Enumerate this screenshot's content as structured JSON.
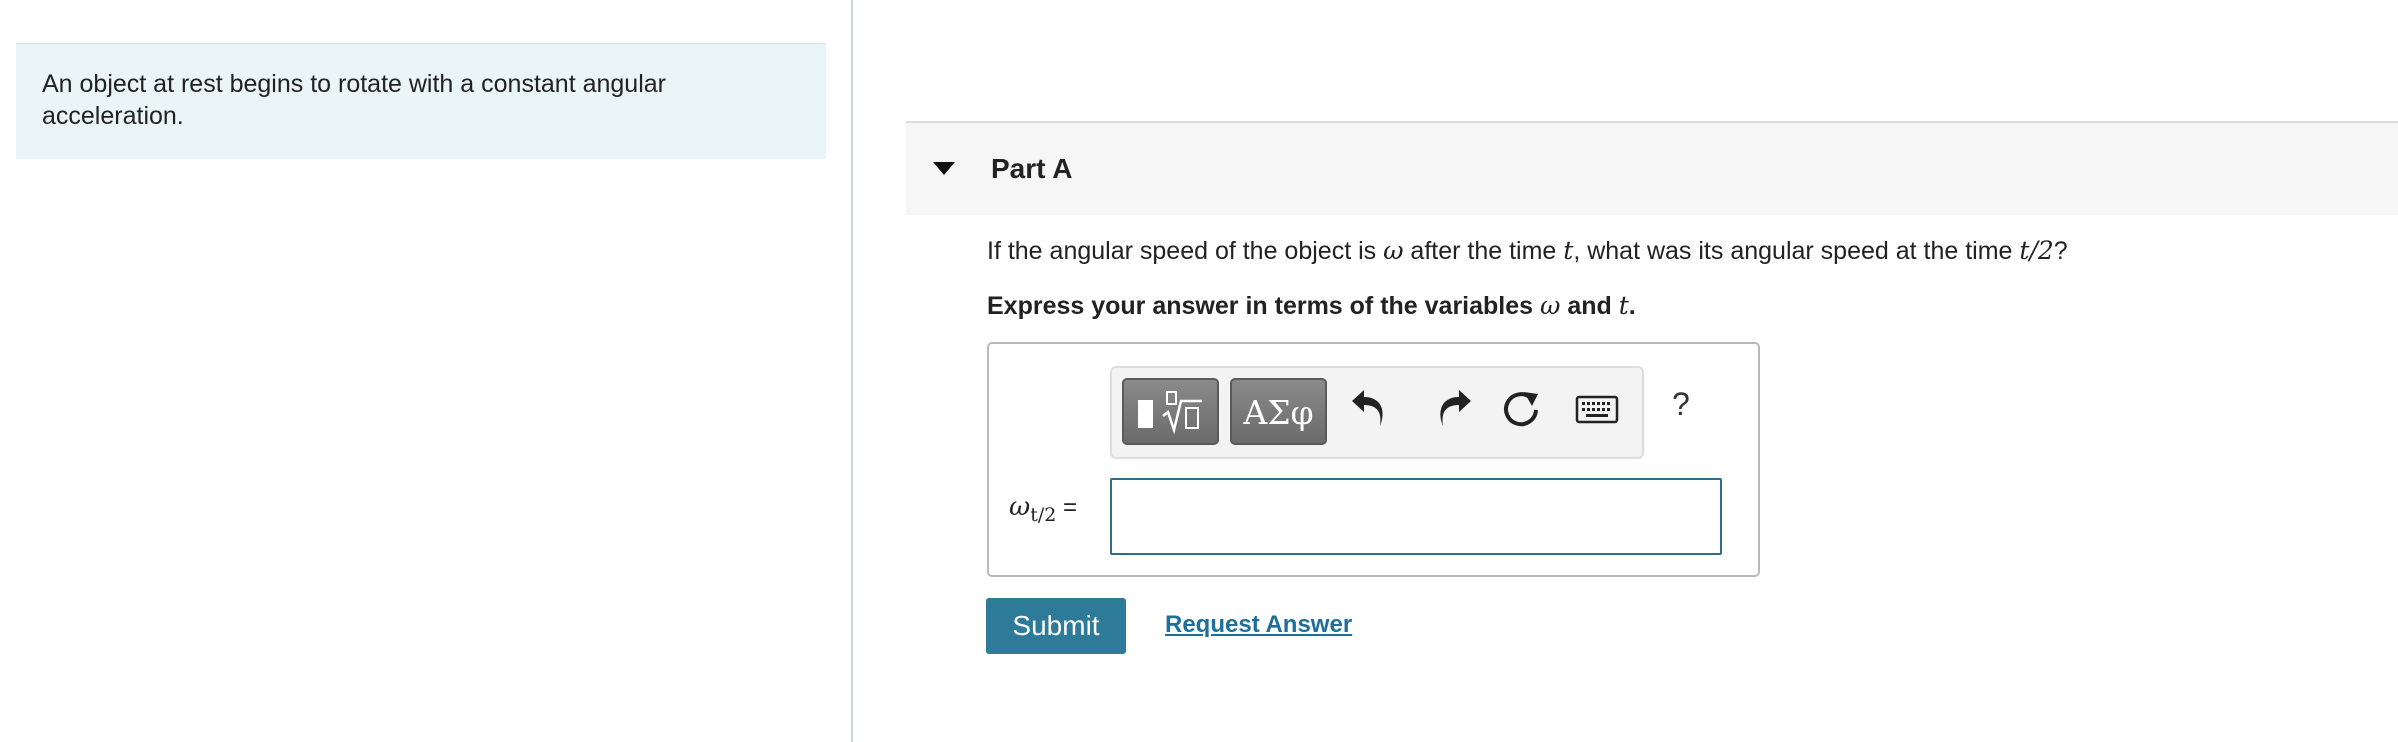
{
  "intro": {
    "text": "An object at rest begins to rotate with a constant angular acceleration."
  },
  "part": {
    "title": "Part A"
  },
  "question": {
    "p1": "If the angular speed of the object is ",
    "v1": "ω",
    "p2": " after the time ",
    "v2": "t",
    "p3": ", what was its angular speed at the time ",
    "v3": "t/2",
    "p4": "?"
  },
  "instruction": {
    "p1": "Express your answer in terms of the variables ",
    "v1": "ω",
    "p2": " and ",
    "v2": "t",
    "p3": "."
  },
  "toolbar": {
    "templates_icon": "square-root-template-icon",
    "greek_label": "ΑΣφ",
    "undo_icon": "undo-icon",
    "redo_icon": "redo-icon",
    "reset_icon": "reset-icon",
    "keyboard_icon": "keyboard-icon",
    "help_label": "?"
  },
  "answer": {
    "label_main": "ω",
    "label_sub": "t/2",
    "label_eq": " =",
    "value": ""
  },
  "actions": {
    "submit_label": "Submit",
    "request_label": "Request Answer"
  },
  "colors": {
    "intro_bg": "#e9f5f7",
    "header_bg": "#f6f6f6",
    "submit_bg": "#2d7a99",
    "link": "#1f6f9c",
    "input_border": "#2b6f8a"
  }
}
